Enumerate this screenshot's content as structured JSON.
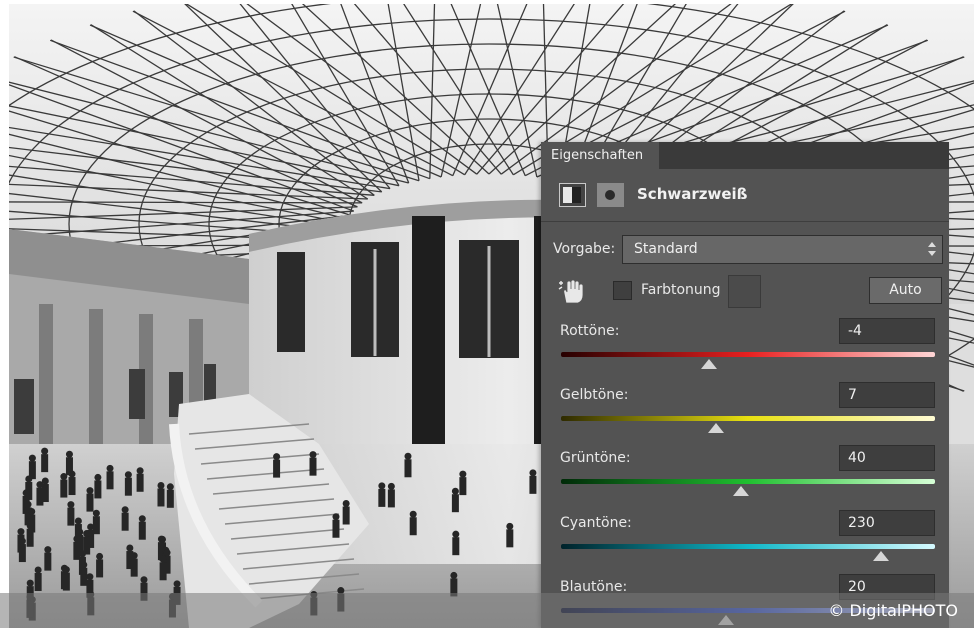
{
  "panel": {
    "tab_label": "Eigenschaften",
    "adjustment_title": "Schwarzweiß",
    "preset_label": "Vorgabe:",
    "preset_value": "Standard",
    "tint_label": "Farbtonung",
    "tint_checked": false,
    "auto_button": "Auto",
    "sliders": [
      {
        "label": "Rottöne:",
        "value": "-4",
        "fraction": 0.395,
        "gradient": [
          "#260000",
          "#e82020",
          "#ffd6d6"
        ]
      },
      {
        "label": "Gelbtöne:",
        "value": "7",
        "fraction": 0.415,
        "gradient": [
          "#2e2a00",
          "#e8e010",
          "#fffcd4"
        ]
      },
      {
        "label": "Grüntöne:",
        "value": "40",
        "fraction": 0.48,
        "gradient": [
          "#002a08",
          "#20c030",
          "#d6ffd6"
        ]
      },
      {
        "label": "Cyantöne:",
        "value": "230",
        "fraction": 0.855,
        "gradient": [
          "#00222a",
          "#10b8c8",
          "#d6faff"
        ]
      },
      {
        "label": "Blautöne:",
        "value": "20",
        "fraction": 0.44,
        "gradient": [
          "#00062a",
          "#3050d0",
          "#d6dcff"
        ]
      }
    ]
  },
  "icons": {
    "adjustment": "black-white-adjustment-icon",
    "mask": "layer-mask-icon",
    "hand": "targeted-adjustment-hand-icon"
  },
  "footer": {
    "copyright": "© DigitalPHOTO"
  }
}
